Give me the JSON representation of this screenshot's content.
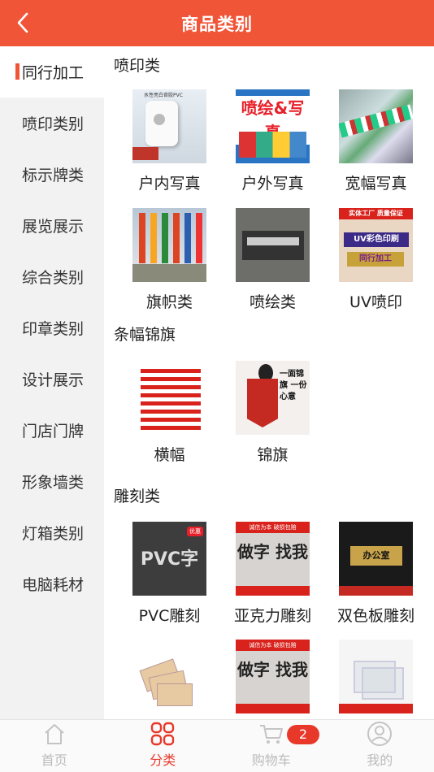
{
  "header": {
    "title": "商品类别"
  },
  "sidebar": {
    "items": [
      {
        "label": "同行加工"
      },
      {
        "label": "喷印类别"
      },
      {
        "label": "标示牌类"
      },
      {
        "label": "展览展示"
      },
      {
        "label": "综合类别"
      },
      {
        "label": "印章类别"
      },
      {
        "label": "设计展示"
      },
      {
        "label": "门店门牌"
      },
      {
        "label": "形象墙类"
      },
      {
        "label": "灯箱类别"
      },
      {
        "label": "电脑耗材"
      }
    ]
  },
  "sections": [
    {
      "title": "喷印类",
      "items": [
        {
          "name": "户内写真"
        },
        {
          "name": "户外写真"
        },
        {
          "name": "宽幅写真"
        },
        {
          "name": "旗帜类"
        },
        {
          "name": "喷绘类"
        },
        {
          "name": "UV喷印"
        }
      ]
    },
    {
      "title": "条幅锦旗",
      "items": [
        {
          "name": "横幅"
        },
        {
          "name": "锦旗"
        }
      ]
    },
    {
      "title": "雕刻类",
      "items": [
        {
          "name": "PVC雕刻"
        },
        {
          "name": "亚克力雕刻"
        },
        {
          "name": "双色板雕刻"
        }
      ]
    }
  ],
  "thumb_text": {
    "pvc_header": "水性亮白背胶PVC",
    "outdoor_big": "喷绘&写真",
    "uv_r1": "实体工厂 质量保证",
    "uv_r2": "UV彩色印刷",
    "uv_r3": "同行加工",
    "pennant_text": "一面锦旗 一份心意",
    "pvc_word": "PVC字",
    "pvc_badge": "优惠",
    "acrylic_top": "诚信为本 破损包赔",
    "acrylic_word": "做字 找我",
    "dual_plate": "办公室"
  },
  "tabbar": {
    "tabs": [
      {
        "label": "首页"
      },
      {
        "label": "分类"
      },
      {
        "label": "购物车"
      },
      {
        "label": "我的"
      }
    ],
    "cart_count": "2"
  },
  "colors": {
    "accent": "#f05538",
    "active_tab": "#e8382a",
    "sidebar_bg": "#f2f2f2"
  }
}
